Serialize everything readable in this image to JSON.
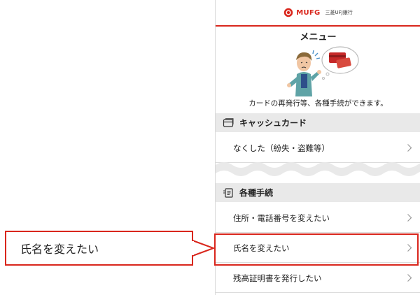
{
  "header": {
    "brand_name": "MUFG",
    "bank_name": "三菱UFJ銀行",
    "brand_color": "#d9261c"
  },
  "menu": {
    "title": "メニュー",
    "intro_text": "カードの再発行等、各種手続ができます。"
  },
  "sections": [
    {
      "title": "キャッシュカード",
      "icon": "card-icon",
      "items": [
        {
          "label": "なくした（紛失・盗難等）"
        }
      ]
    },
    {
      "title": "各種手続",
      "icon": "document-icon",
      "items": [
        {
          "label": "住所・電話番号を変えたい"
        },
        {
          "label": "氏名を変えたい"
        },
        {
          "label": "残高証明書を発行したい"
        }
      ]
    }
  ],
  "callout": {
    "text": "氏名を変えたい",
    "color": "#d9261c"
  }
}
